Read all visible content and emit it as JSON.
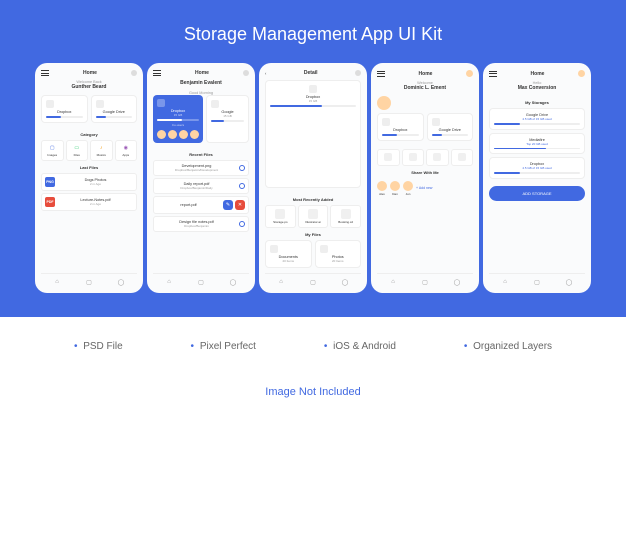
{
  "title": "Storage Management App UI Kit",
  "features": [
    "PSD File",
    "Pixel Perfect",
    "iOS & Android",
    "Organized Layers"
  ],
  "footer": "Image Not Included",
  "s1": {
    "hdr": "Home",
    "gr": "Welcome Back",
    "nm": "Gunther Beard",
    "c1": {
      "n": "Dropbox",
      "s": ""
    },
    "c2": {
      "n": "Google Drive",
      "s": ""
    },
    "sec1": "Category",
    "cats": [
      {
        "l": "Images",
        "c": "#4169E1"
      },
      {
        "l": "Files",
        "c": "#2ecc71"
      },
      {
        "l": "Musics",
        "c": "#f39c12"
      },
      {
        "l": "Apps",
        "c": "#9b59b6"
      }
    ],
    "sec2": "Last Files",
    "f1": {
      "t": "Dogs Photos",
      "s": "2 m Ago",
      "b": "PNG",
      "bc": "#4169E1"
    },
    "f2": {
      "t": "Lecture-Notes.pdf",
      "s": "2 m Ago",
      "b": "PDF",
      "bc": "#e74c3c"
    }
  },
  "s2": {
    "hdr": "Home",
    "gr": "Good Morning",
    "nm": "Benjamin Evalent",
    "c1": {
      "n": "Dropbox",
      "s": "15 GB",
      "co": "Co-users"
    },
    "c2": {
      "n": "Google",
      "s": "15 GB"
    },
    "sec": "Recent Files",
    "f1": {
      "t": "Development.png",
      "s": "Dropbox/Benjamin/Development"
    },
    "f2": {
      "t": "Daily report.pdf",
      "s": "Dropbox/Benjamin/Daily"
    },
    "f3": {
      "t": "report.pdf",
      "s": "Dropbox/Benjamin/Daily"
    },
    "f4": {
      "t": "Design file notes.pdf",
      "s": "Dropbox/Benjamin"
    }
  },
  "s3": {
    "hdr": "Detail",
    "nm": "Dropbox",
    "sz": "15 GB",
    "sec1": "Most Recently Added",
    "r": [
      {
        "t": "Storage.ps"
      },
      {
        "t": "Illustrator.ai"
      },
      {
        "t": "Booking.xd"
      }
    ],
    "sec2": "My Files",
    "g": [
      {
        "t": "Documents",
        "s": "20 Items"
      },
      {
        "t": "Photos",
        "s": "20 Items"
      }
    ]
  },
  "s4": {
    "hdr": "Home",
    "gr": "Welcome",
    "nm": "Dominic L. Ement",
    "c1": {
      "n": "Dropbox"
    },
    "c2": {
      "n": "Google Drive"
    },
    "sec": "Share With Me",
    "sh": [
      {
        "n": "Alex"
      },
      {
        "n": "Dan"
      },
      {
        "n": "Jon"
      }
    ],
    "add": "+ Add new"
  },
  "s5": {
    "hdr": "Home",
    "gr": "Hello",
    "nm": "Max Conversion",
    "sec": "My Storages",
    "st": [
      {
        "t": "Google Drive",
        "s": "4.5 GB of 15 GB used"
      },
      {
        "t": "Mediafire",
        "s": "Top 20 GB used"
      },
      {
        "t": "Dropbox",
        "s": "4.5 GB of 15 GB used"
      }
    ],
    "btn": "ADD STORAGE"
  }
}
